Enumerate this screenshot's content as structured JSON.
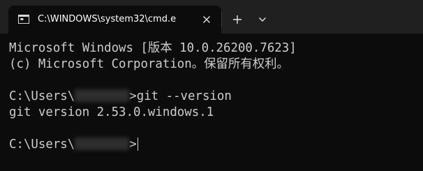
{
  "window": {
    "tab_title": "C:\\WINDOWS\\system32\\cmd.e",
    "new_tab_label": "+",
    "icons": {
      "app": "cmd-icon",
      "close": "close-icon",
      "new_tab": "plus-icon",
      "dropdown": "chevron-down-icon"
    }
  },
  "terminal": {
    "banner_line1": "Microsoft Windows [版本 10.0.26200.7623]",
    "banner_line2": "(c) Microsoft Corporation。保留所有权利。",
    "prompt1_prefix": "C:\\Users\\",
    "prompt1_suffix": ">",
    "command1": "git --version",
    "output1": "git version 2.53.0.windows.1",
    "prompt2_prefix": "C:\\Users\\",
    "prompt2_suffix": ">"
  },
  "colors": {
    "background": "#0c0c0c",
    "tabbar": "#202020",
    "text": "#cccccc"
  }
}
